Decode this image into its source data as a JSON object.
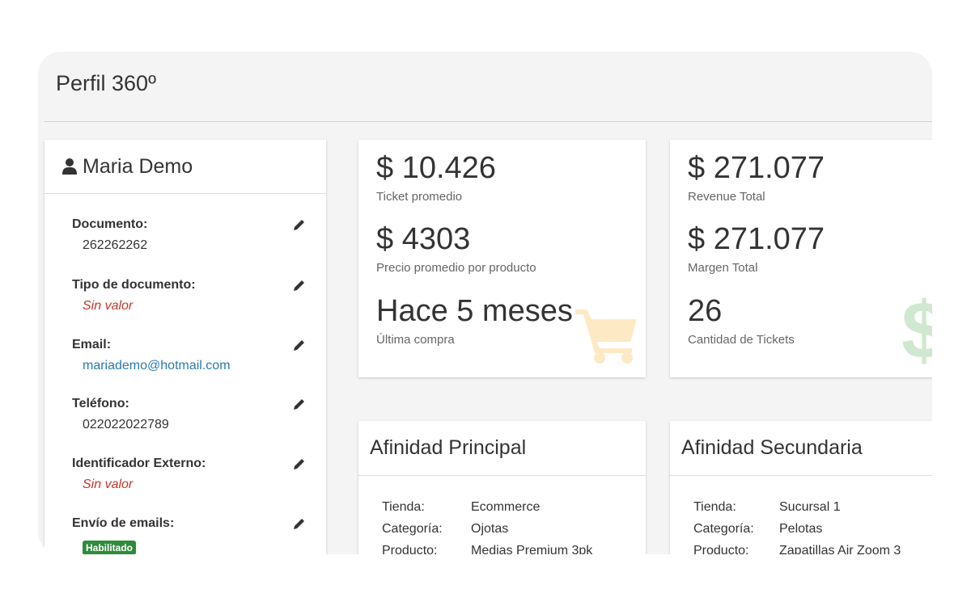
{
  "page": {
    "title": "Perfil 360º"
  },
  "profile": {
    "name": "Maria Demo",
    "fields": [
      {
        "label": "Documento:",
        "value": "262262262"
      },
      {
        "label": "Tipo de documento:",
        "value": "Sin valor"
      },
      {
        "label": "Email:",
        "value": "mariademo@hotmail.com"
      },
      {
        "label": "Teléfono:",
        "value": "022022022789"
      },
      {
        "label": "Identificador Externo:",
        "value": "Sin valor"
      },
      {
        "label": "Envío de emails:",
        "value": "Habilitado"
      }
    ]
  },
  "stats_left": [
    {
      "value": "$ 10.426",
      "label": "Ticket promedio"
    },
    {
      "value": "$ 4303",
      "label": "Precio promedio por producto"
    },
    {
      "value": "Hace 5 meses",
      "label": "Última compra"
    }
  ],
  "stats_right": [
    {
      "value": "$ 271.077",
      "label": "Revenue Total"
    },
    {
      "value": "$ 271.077",
      "label": "Margen Total"
    },
    {
      "value": "26",
      "label": "Cantidad de Tickets"
    }
  ],
  "affinity_primary": {
    "title": "Afinidad Principal",
    "rows": [
      {
        "key": "Tienda:",
        "value": "Ecommerce"
      },
      {
        "key": "Categoría:",
        "value": "Ojotas"
      },
      {
        "key": "Producto:",
        "value": "Medias Premium 3pk"
      }
    ]
  },
  "affinity_secondary": {
    "title": "Afinidad Secundaria",
    "rows": [
      {
        "key": "Tienda:",
        "value": "Sucursal 1"
      },
      {
        "key": "Categoría:",
        "value": "Pelotas"
      },
      {
        "key": "Producto:",
        "value": "Zapatillas Air Zoom 3"
      }
    ]
  },
  "icons": {
    "user": "user-icon",
    "edit": "pencil-icon",
    "cart": "shopping-cart-icon",
    "dollar": "dollar-sign-icon"
  },
  "colors": {
    "empty_value": "#c0392b",
    "link": "#2a7ab0",
    "badge": "#2e8b3a",
    "cart_icon": "#fde9c4",
    "dollar_icon": "#cfe8cf"
  }
}
